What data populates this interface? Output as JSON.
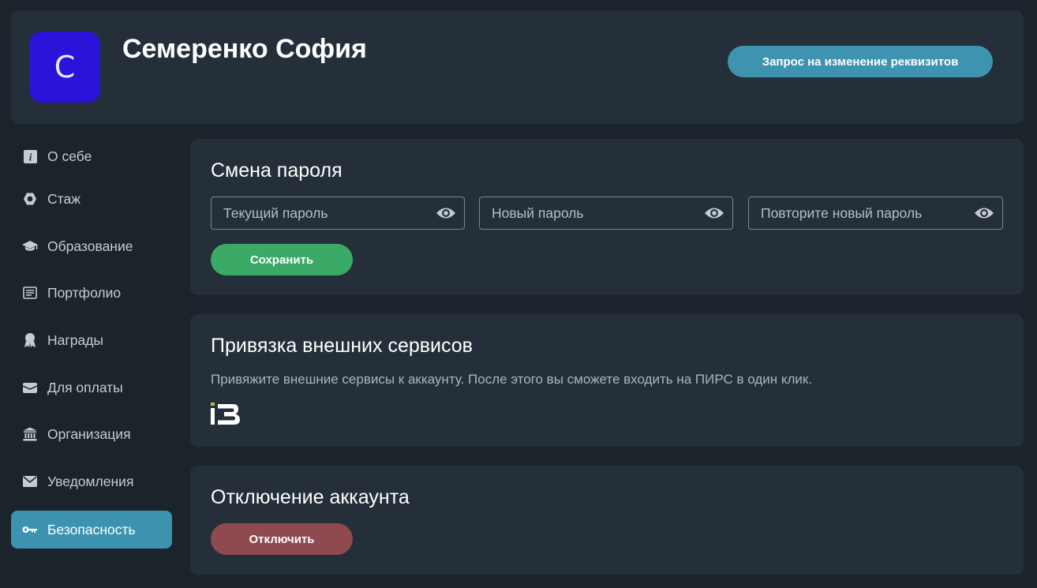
{
  "header": {
    "avatar_letter": "С",
    "user_name": "Семеренко София",
    "request_button": "Запрос на изменение реквизитов"
  },
  "sidebar": {
    "items": [
      {
        "label": "О себе",
        "icon": "info-icon"
      },
      {
        "label": "Стаж",
        "icon": "hexagon-icon"
      },
      {
        "label": "Образование",
        "icon": "graduation-cap-icon"
      },
      {
        "label": "Портфолио",
        "icon": "document-icon"
      },
      {
        "label": "Награды",
        "icon": "award-icon"
      },
      {
        "label": "Для оплаты",
        "icon": "wallet-icon"
      },
      {
        "label": "Организация",
        "icon": "institution-icon"
      },
      {
        "label": "Уведомления",
        "icon": "envelope-icon"
      },
      {
        "label": "Безопасность",
        "icon": "key-icon",
        "active": true
      }
    ]
  },
  "password_card": {
    "title": "Смена пароля",
    "current_placeholder": "Текущий пароль",
    "new_placeholder": "Новый пароль",
    "repeat_placeholder": "Повторите новый пароль",
    "save_label": "Сохранить"
  },
  "services_card": {
    "title": "Привязка внешних сервисов",
    "description": "Привяжите внешние сервисы к аккаунту. После этого вы сможете входить на ПИРС в один клик.",
    "service_logo_text": "iB"
  },
  "disable_card": {
    "title": "Отключение аккаунта",
    "disable_label": "Отключить"
  },
  "colors": {
    "background": "#1b232b",
    "card": "#252f3a",
    "accent": "#3c93b0",
    "success": "#3baa66",
    "danger": "#8e4a4f",
    "avatar": "#2a14d9"
  }
}
